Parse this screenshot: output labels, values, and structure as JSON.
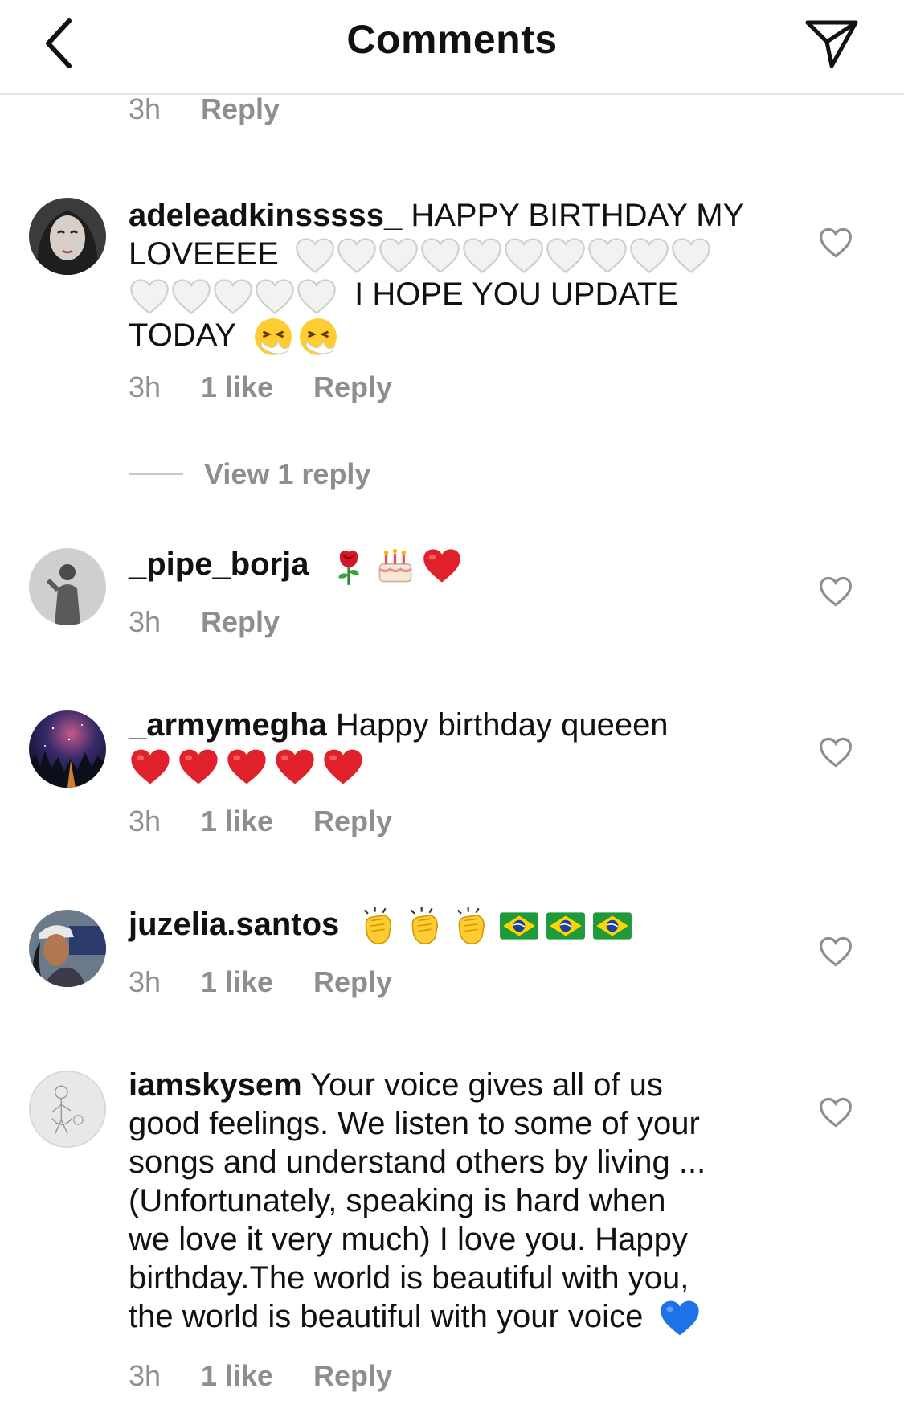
{
  "header": {
    "title": "Comments"
  },
  "top_partial": {
    "time": "3h",
    "reply": "Reply"
  },
  "comments": [
    {
      "username": "adeleadkinsssss_",
      "text_1": "HAPPY BIRTHDAY MY",
      "text_2": "LOVEEEE",
      "text_3": "I HOPE YOU UPDATE",
      "text_4": "TODAY",
      "time": "3h",
      "likes": "1 like",
      "reply": "Reply",
      "view_replies": "View 1 reply"
    },
    {
      "username": "_pipe_borja",
      "time": "3h",
      "reply": "Reply"
    },
    {
      "username": "_armymegha",
      "text": "Happy birthday queeen",
      "time": "3h",
      "likes": "1 like",
      "reply": "Reply"
    },
    {
      "username": "juzelia.santos",
      "time": "3h",
      "likes": "1 like",
      "reply": "Reply"
    },
    {
      "username": "iamskysem",
      "text_1": "Your voice gives all of us",
      "text_2": "good feelings. We listen to some of your",
      "text_3": "songs and understand others by living ...",
      "text_4": "(Unfortunately, speaking is hard when",
      "text_5": "we love it very much) I love you. Happy",
      "text_6": "birthday.The world is beautiful with you,",
      "text_7": "the world is beautiful with your voice",
      "time": "3h",
      "likes": "1 like",
      "reply": "Reply"
    }
  ],
  "icons": {
    "back": "chevron-left-icon",
    "share": "paper-plane-icon",
    "like": "heart-outline-icon",
    "white_heart": "white-heart-emoji",
    "sneeze": "sneezing-face-emoji",
    "rose": "rose-emoji",
    "cake": "birthday-cake-emoji",
    "red_heart": "red-heart-emoji",
    "clap": "clapping-hands-emoji",
    "brazil_flag": "brazil-flag-emoji",
    "blue_heart": "blue-heart-emoji"
  },
  "colors": {
    "meta_gray": "#8e8e8e",
    "text": "#111111",
    "red_heart": "#e0202a",
    "blue_heart": "#1d72e8"
  }
}
